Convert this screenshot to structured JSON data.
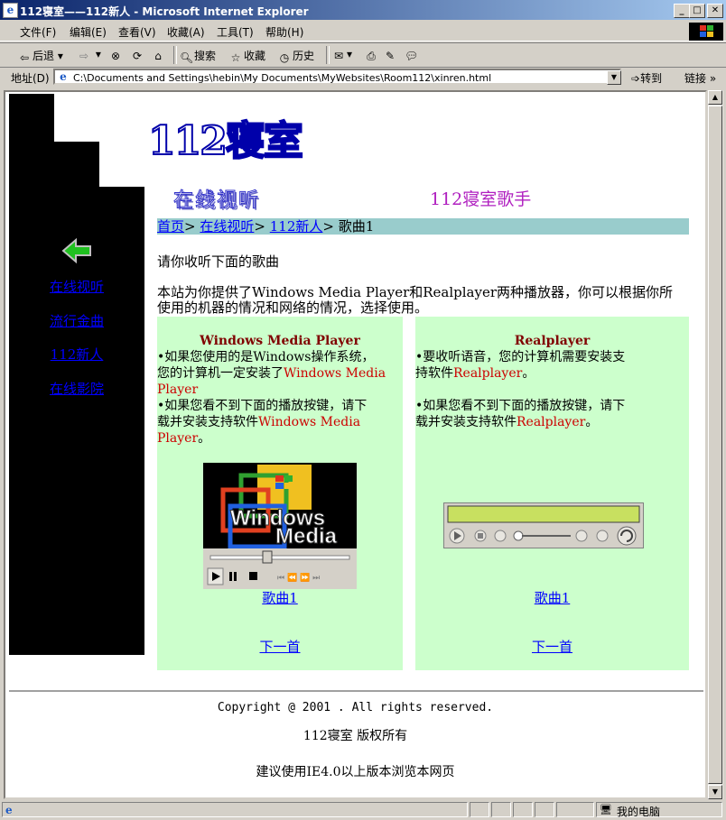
{
  "window": {
    "title": "112寝室——112新人 - Microsoft Internet Explorer"
  },
  "menu": [
    "文件(F)",
    "编辑(E)",
    "查看(V)",
    "收藏(A)",
    "工具(T)",
    "帮助(H)"
  ],
  "toolbar": {
    "back": "后退",
    "search": "搜索",
    "favorites": "收藏",
    "history": "历史"
  },
  "address": {
    "label": "地址(D)",
    "url": "C:\\Documents and Settings\\hebin\\My Documents\\MyWebsites\\Room112\\xinren.html",
    "go": "转到",
    "links": "链接 »"
  },
  "sidebar": {
    "links": [
      "在线视听",
      "流行金曲",
      "112新人",
      "在线影院"
    ]
  },
  "header": {
    "logo": "112寝室",
    "section": "在线视听",
    "subtitle": "112寝室歌手"
  },
  "breadcrumb": {
    "home": "首页",
    "online": "在线视听",
    "newbie": "112新人",
    "current": "歌曲1",
    "sep": ">"
  },
  "content": {
    "intro": "请你收听下面的歌曲",
    "desc": "本站为你提供了Windows Media Player和Realplayer两种播放器，你可以根据你所使用的机器的情况和网络的情况，选择使用。"
  },
  "left_panel": {
    "title": "Windows Media Player",
    "l1a": "•如果您使用的是Windows操作系统，",
    "l1b": "您的计算机一定安装了",
    "l1c": "Windows Media Player",
    "l2a": "•如果您看不到下面的播放按键，请下",
    "l2b": "载并安装支持软件",
    "l2c": "Windows Media Player",
    "dot": "。",
    "song_link": "歌曲1",
    "next_link": "下一首",
    "player_caption_1": "Windows",
    "player_caption_2": "Media"
  },
  "right_panel": {
    "title": "Realplayer",
    "l1a": "•要收听语音，您的计算机需要安装支",
    "l1b": "持软件",
    "l1c": "Realplayer",
    "l2a": "•如果您看不到下面的播放按键，请下",
    "l2b": "载并安装支持软件",
    "l2c": "Realplayer",
    "dot": "。",
    "song_link": "歌曲1",
    "next_link": "下一首"
  },
  "footer": {
    "copyright": "Copyright @ 2001 . All rights reserved.",
    "rights": "112寝室 版权所有",
    "advice": "建议使用IE4.0以上版本浏览本网页"
  },
  "status": {
    "zone": "我的电脑"
  },
  "colors": {
    "sidebar": "#000000",
    "breadcrumb_bg": "#99cccc",
    "panel_bg": "#ccffcc",
    "link": "#0000ff",
    "subtitle": "#b020c0"
  }
}
